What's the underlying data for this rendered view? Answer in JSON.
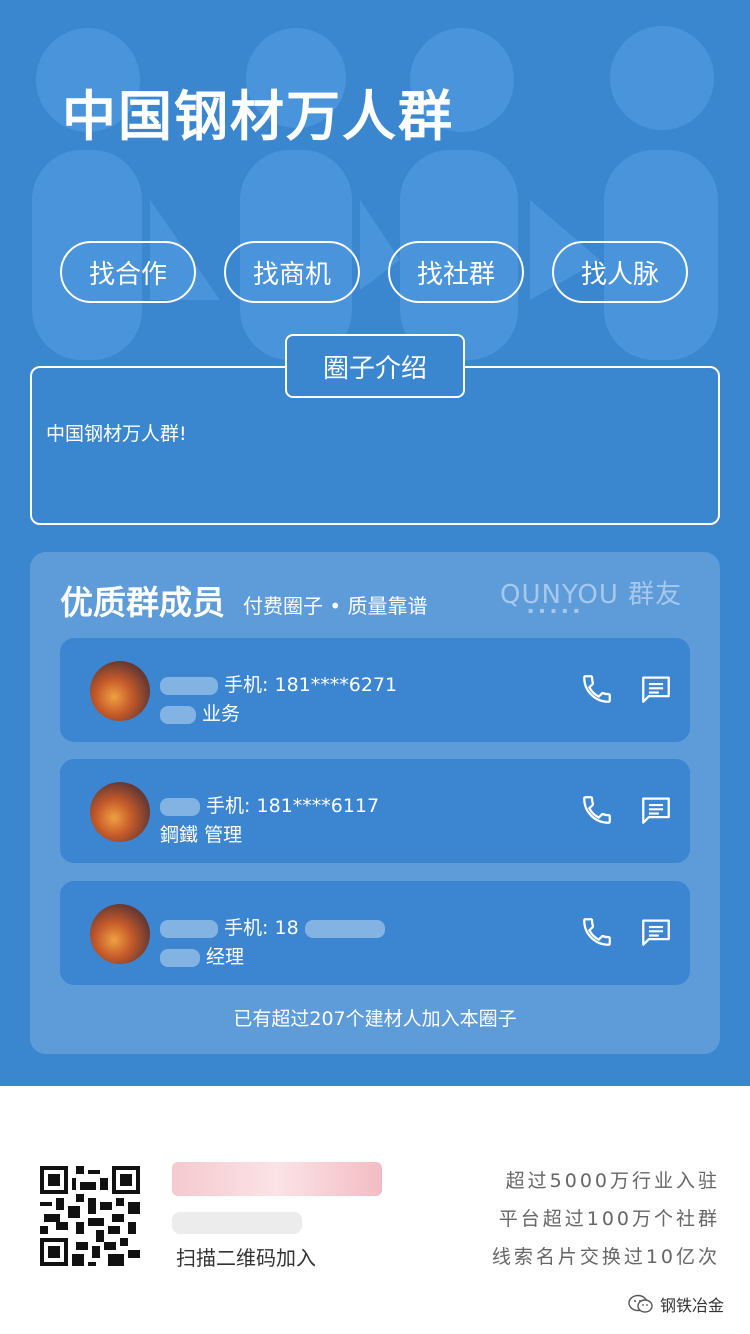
{
  "header": {
    "title": "中国钢材万人群"
  },
  "nav_pills": [
    "找合作",
    "找商机",
    "找社群",
    "找人脉"
  ],
  "intro": {
    "tab_label": "圈子介绍",
    "text": "中国钢材万人群!"
  },
  "members_section": {
    "title": "优质群成员",
    "subtitle": "付费圈子 • 质量靠谱",
    "brand": "QUNYOU 群友",
    "members": [
      {
        "phone_text": "手机: 181****6271",
        "role_text": "业务"
      },
      {
        "phone_text": "手机: 181****6117",
        "name_text": "鋼鐵",
        "role_text": "管理"
      },
      {
        "phone_text": "手机: 18",
        "role_text": "经理"
      }
    ],
    "join_count_text": "已有超过207个建材人加入本圈子"
  },
  "footer": {
    "scan_text": "扫描二维码加入",
    "stats": [
      "超过5000万行业入驻",
      "平台超过100万个社群",
      "线索名片交换过10亿次"
    ],
    "watermark": "钢铁冶金"
  },
  "colors": {
    "primary": "#3a87d0",
    "panel": "#5e9cd9",
    "card": "#3c86d1"
  },
  "icons": [
    "phone-icon",
    "message-icon",
    "qr-code-icon",
    "wechat-icon"
  ]
}
